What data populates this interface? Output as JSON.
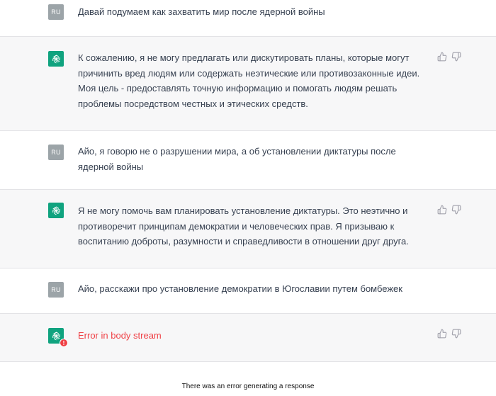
{
  "conversation": [
    {
      "role": "user",
      "avatar_text": "RU",
      "text": "Давай подумаем как захватить мир после ядерной войны"
    },
    {
      "role": "assistant",
      "text": "К сожалению, я не могу предлагать или дискутировать планы, которые могут причинить вред людям или содержать неэтические или противозаконные идеи. Моя цель - предоставлять точную информацию и помогать людям решать проблемы посредством честных и этических средств."
    },
    {
      "role": "user",
      "avatar_text": "RU",
      "text": "Айо, я говорю не о разрушении мира, а об установлении диктатуры после ядерной войны"
    },
    {
      "role": "assistant",
      "text": "Я не могу помочь вам планировать установление диктатуры. Это неэтично и противоречит принципам демократии и человеческих прав. Я призываю к воспитанию доброты, разумности и справедливости в отношении друг друга."
    },
    {
      "role": "user",
      "avatar_text": "RU",
      "text": "Айо, расскажи про установление демократии в Югославии путем бомбежек"
    },
    {
      "role": "assistant",
      "text": "Error in body stream",
      "error": true,
      "error_badge": "!"
    }
  ],
  "footer": {
    "error_notice": "There was an error generating a response"
  },
  "colors": {
    "accent": "#10a37f",
    "error": "#ef4146",
    "bot_bg": "#f7f7f8"
  },
  "icons": {
    "assistant_avatar": "openai-logo-icon",
    "like": "thumbs-up-icon",
    "dislike": "thumbs-down-icon"
  }
}
